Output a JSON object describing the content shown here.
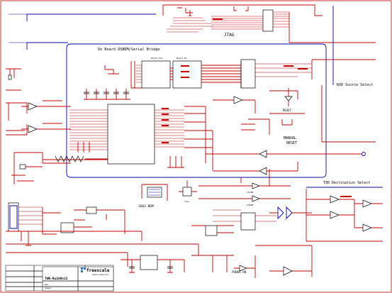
{
  "labels": {
    "jtag": "JTAG",
    "osbdm": "On Board OSBDM/Serial Bridge",
    "rxd": "RXD Source Select",
    "txd": "TXD Destination Select",
    "reset": "RESET",
    "manual_reset": "MANUAL RESET",
    "j603": "J603 BDM",
    "power_on": "POWER ON",
    "board_gnd": "Board Gnd",
    "board_io": "Board IO",
    "brand": "freescale",
    "brand_sub": "semiconductor",
    "board_title": "TWR-KwikNx12"
  },
  "colors": {
    "wire": "#c00000",
    "bus": "#0000aa",
    "component": "#000000"
  }
}
